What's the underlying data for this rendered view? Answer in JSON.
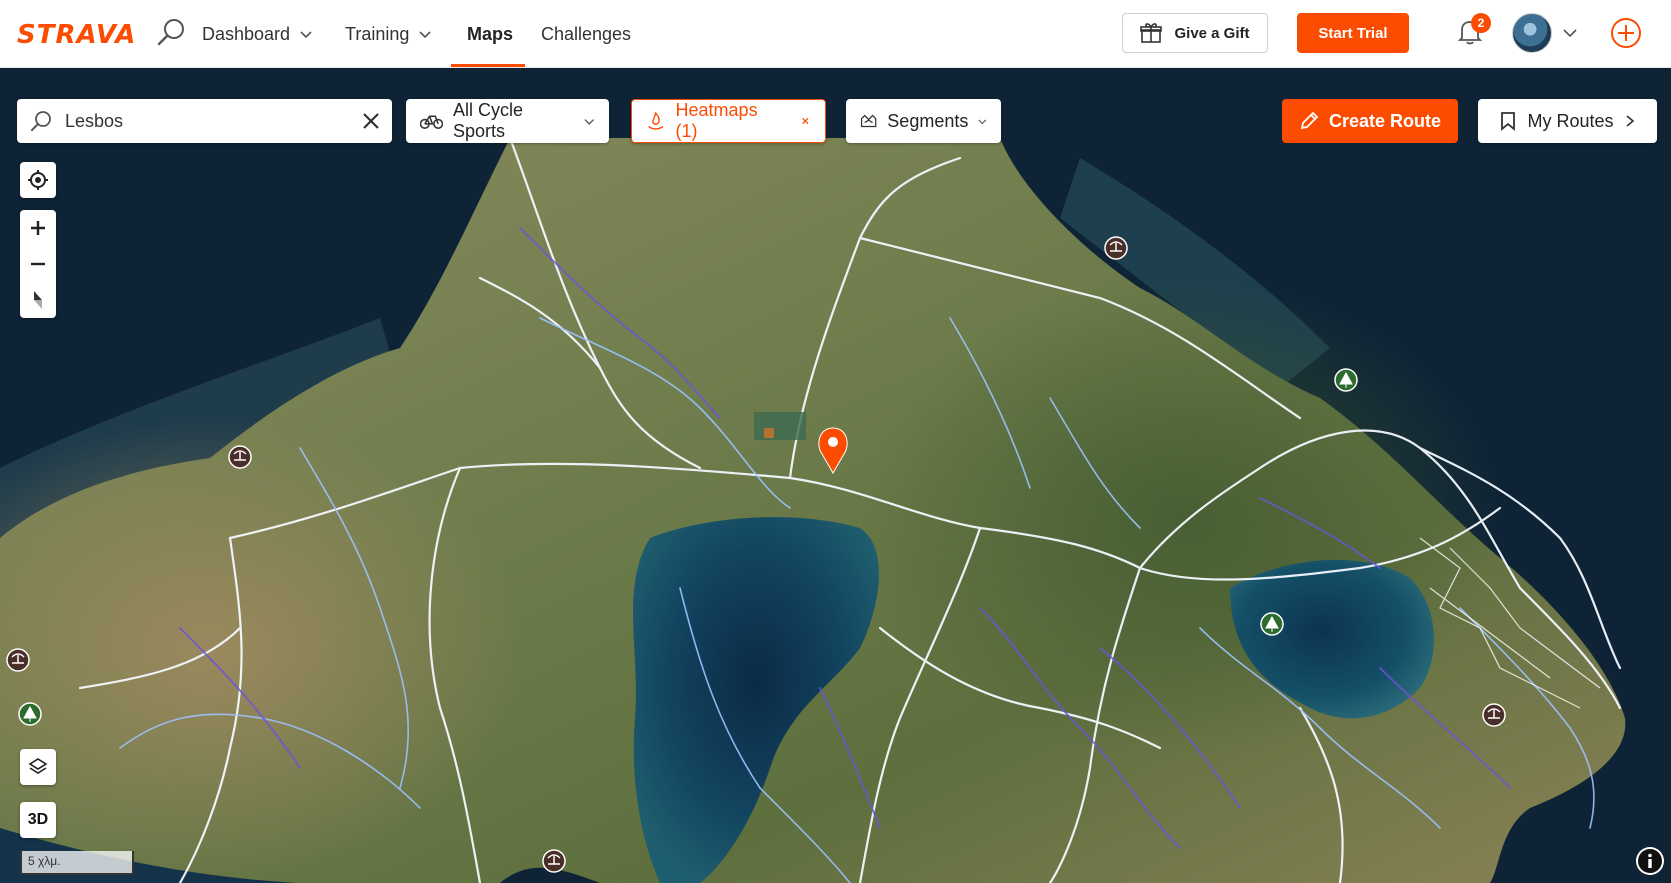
{
  "brand": {
    "logo_text": "STRAVA",
    "accent": "#fc4c02"
  },
  "nav": {
    "items": [
      {
        "label": "Dashboard",
        "has_menu": true
      },
      {
        "label": "Training",
        "has_menu": true
      },
      {
        "label": "Maps",
        "active": true
      },
      {
        "label": "Challenges"
      }
    ],
    "gift_label": "Give a Gift",
    "trial_label": "Start Trial",
    "notification_count": "2"
  },
  "map_toolbar": {
    "search_value": "Lesbos",
    "sport_filter": "All Cycle Sports",
    "heatmaps_label": "Heatmaps (1)",
    "segments_label": "Segments",
    "create_route_label": "Create Route",
    "my_routes_label": "My Routes"
  },
  "map_controls": {
    "three_d_label": "3D",
    "scale_label": "5 χλμ."
  },
  "map_colors": {
    "sea": "#123048",
    "land": "#7d8a57",
    "heat_white": "#ffffff",
    "heat_blue": "#8fb8ff",
    "heat_purple": "#6a52d4"
  }
}
